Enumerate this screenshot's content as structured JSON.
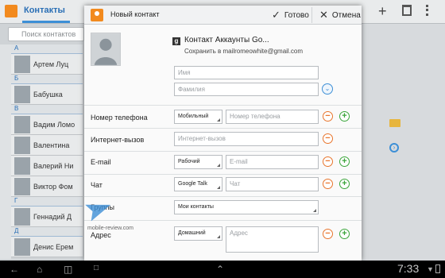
{
  "background": {
    "tab_label": "Контакты",
    "search_placeholder": "Поиск контактов",
    "index_letters": [
      "A",
      "Б",
      "В",
      "Г",
      "Д"
    ],
    "contacts": [
      {
        "letter": "А"
      },
      {
        "name": "Артем Луц"
      },
      {
        "letter": "Б"
      },
      {
        "name": "Бабушка"
      },
      {
        "letter": "В"
      },
      {
        "name": "Вадим Ломо"
      },
      {
        "name": "Валентина"
      },
      {
        "name": "Валерий Ни"
      },
      {
        "name": "Виктор Фом"
      },
      {
        "letter": "Г"
      },
      {
        "name": "Геннадий Д"
      },
      {
        "letter": "Д"
      },
      {
        "name": "Денис Ерем"
      }
    ]
  },
  "dialog": {
    "title": "Новый контакт",
    "done_label": "Готово",
    "cancel_label": "Отмена",
    "account_title": "Контакт Аккаунты Go...",
    "account_subtitle": "Сохранить в mailromeowhite@gmail.com",
    "name_placeholder": "Имя",
    "surname_placeholder": "Фамилия",
    "rows": {
      "phone": {
        "label": "Номер телефона",
        "type": "Мобильный",
        "placeholder": "Номер телефона"
      },
      "internet_call": {
        "label": "Интернет-вызов",
        "placeholder": "Интернет-вызов"
      },
      "email": {
        "label": "E-mail",
        "type": "Рабочий",
        "placeholder": "E-mail"
      },
      "chat": {
        "label": "Чат",
        "type": "Google Talk",
        "placeholder": "Чат"
      },
      "groups": {
        "label": "Группы",
        "value": "Мои контакты"
      },
      "address": {
        "label": "Адрес",
        "type": "Домашний",
        "placeholder": "Адрес"
      }
    }
  },
  "watermark": "mobile-review.com",
  "system_bar": {
    "time": "7:33"
  },
  "colors": {
    "accent": "#3d8fd6",
    "remove": "#e8742b",
    "add": "#3aa53a",
    "brand": "#f28a1e"
  }
}
